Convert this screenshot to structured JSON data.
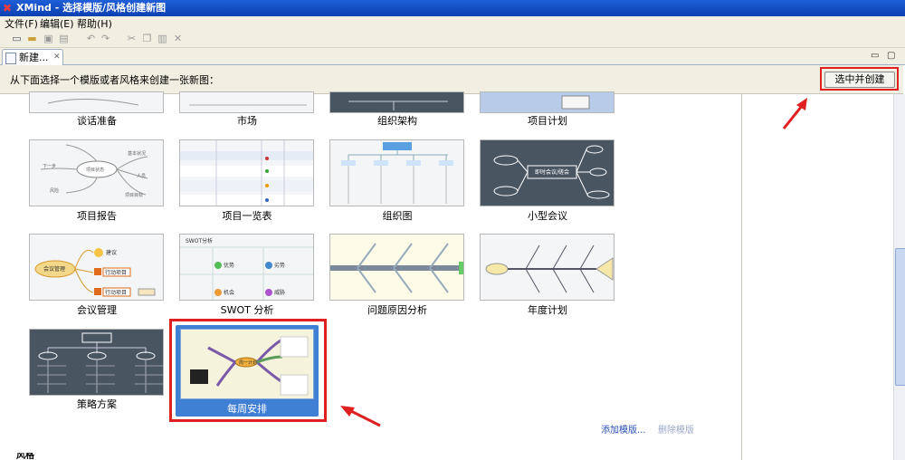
{
  "window": {
    "title": "XMind - 选择模版/风格创建新图"
  },
  "menu": {
    "file": "文件(F)",
    "edit": "编辑(E)",
    "help": "帮助(H)"
  },
  "tab": {
    "label": "新建..."
  },
  "header": {
    "instruction": "从下面选择一个模版或者风格来创建一张新图：",
    "create_button": "选中并创建"
  },
  "templates": {
    "row0": [
      "谈话准备",
      "市场",
      "组织架构",
      "项目计划"
    ],
    "row1": [
      "项目报告",
      "项目一览表",
      "组织图",
      "小型会议"
    ],
    "row2": [
      "会议管理",
      "SWOT 分析",
      "问题原因分析",
      "年度计划"
    ],
    "row3": [
      "策略方案",
      "每周安排"
    ]
  },
  "thumbs": {
    "report": {
      "center": "项目状态",
      "a": "下一步",
      "b": "基本状况",
      "c": "人员",
      "d": "项目目标",
      "e": "风险"
    },
    "meeting": {
      "center": "即时会议/磋会"
    },
    "mgmt": {
      "center": "会议管理",
      "a": "建议",
      "b": "行动项目",
      "c": "行动项目"
    },
    "swot": {
      "title": "SWOT分析",
      "s": "优势",
      "w": "劣势",
      "o": "机会",
      "t": "威胁"
    },
    "weekly": {
      "center": "周一计划"
    }
  },
  "actions": {
    "add": "添加模版...",
    "delete": "删除模版"
  },
  "section_partial": "风格"
}
